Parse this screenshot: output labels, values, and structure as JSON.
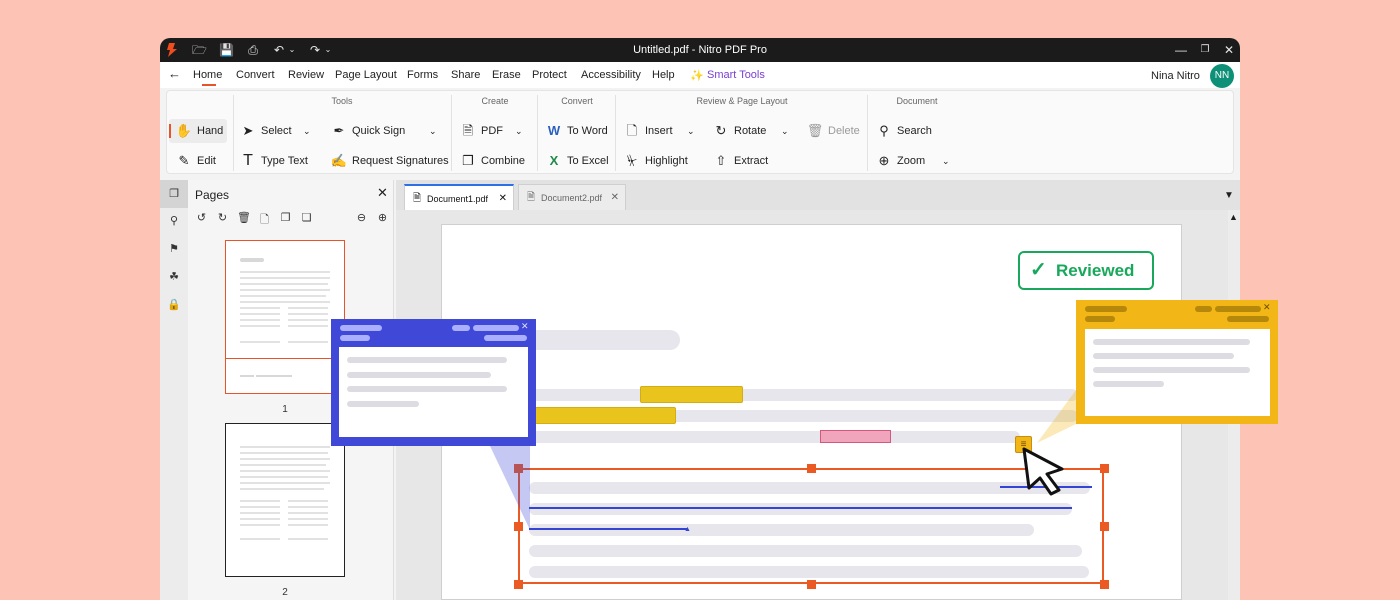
{
  "window": {
    "title": "Untitled.pdf - Nitro PDF Pro"
  },
  "menu": {
    "items": [
      "Home",
      "Convert",
      "Review",
      "Page Layout",
      "Forms",
      "Share",
      "Erase",
      "Protect",
      "Accessibility",
      "Help"
    ],
    "smart_tools": "Smart Tools",
    "user_name": "Nina Nitro",
    "avatar_initials": "NN"
  },
  "ribbon": {
    "groups": {
      "tools": "Tools",
      "create": "Create",
      "convert": "Convert",
      "review": "Review & Page Layout",
      "document": "Document"
    },
    "buttons": {
      "hand": "Hand",
      "edit": "Edit",
      "select": "Select",
      "type_text": "Type Text",
      "quick_sign": "Quick Sign",
      "request_signatures": "Request Signatures",
      "pdf": "PDF",
      "combine": "Combine",
      "to_word": "To Word",
      "to_excel": "To Excel",
      "insert": "Insert",
      "highlight": "Highlight",
      "rotate": "Rotate",
      "extract": "Extract",
      "delete": "Delete",
      "search": "Search",
      "zoom": "Zoom"
    }
  },
  "pages_panel": {
    "title": "Pages",
    "page_numbers": [
      "1",
      "2"
    ]
  },
  "tabs": [
    {
      "label": "Document1.pdf",
      "active": true
    },
    {
      "label": "Document2.pdf",
      "active": false
    }
  ],
  "document": {
    "stamp": "Reviewed"
  },
  "colors": {
    "accent": "#e8542a",
    "avatar": "#0e8f77",
    "smart_tools": "#7a3fd0",
    "reviewed": "#19a85b",
    "comment_blue": "#3f48d7",
    "comment_yellow": "#f2b617",
    "highlight": "#e8c41c",
    "selection": "#ea5a22"
  }
}
